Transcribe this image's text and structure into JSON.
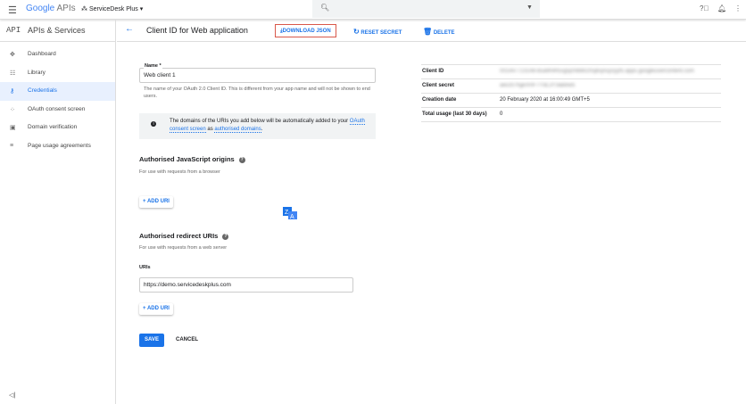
{
  "topbar": {
    "logo_brand": "Google",
    "logo_product": "APIs",
    "project": "ServiceDesk Plus"
  },
  "sidebar": {
    "api_badge": "API",
    "title": "APIs & Services",
    "items": [
      {
        "label": "Dashboard",
        "icon": "dashboard-icon"
      },
      {
        "label": "Library",
        "icon": "library-icon"
      },
      {
        "label": "Credentials",
        "icon": "key-icon",
        "active": true
      },
      {
        "label": "OAuth consent screen",
        "icon": "consent-icon"
      },
      {
        "label": "Domain verification",
        "icon": "domain-icon"
      },
      {
        "label": "Page usage agreements",
        "icon": "agreements-icon"
      }
    ]
  },
  "header": {
    "title": "Client ID for Web application",
    "download": "DOWNLOAD JSON",
    "reset": "RESET SECRET",
    "delete": "DELETE"
  },
  "form": {
    "name_label": "Name *",
    "name_value": "Web client 1",
    "name_help": "The name of your OAuth 2.0 Client ID. This is different from your app name and will not be shown to end users.",
    "info_pre": "The domains of the URIs you add below will be automatically added to your ",
    "info_link1": "OAuth consent screen",
    "info_mid": " as ",
    "info_link2": "authorised domains",
    "info_post": ".",
    "js_title": "Authorised JavaScript origins",
    "js_help": "For use with requests from a browser",
    "add_uri": "+ ADD URI",
    "redirect_title": "Authorised redirect URIs",
    "redirect_help": "For use with requests from a web server",
    "uris_label": "URIs",
    "uri_value": "https://demo.servicedeskplus.com",
    "add_uri2": "+ ADD URI",
    "save": "SAVE",
    "cancel": "CANCEL"
  },
  "details": [
    {
      "key": "Client ID",
      "value": "001447723148-8ua9h4h5sg5j0nbb61h5jbsjnuysyyf5.apps.googleusercontent.com",
      "blurred": true
    },
    {
      "key": "Client secret",
      "value": "aeDzt7hgeXHFTYdL3Y3aBew5",
      "blurred": true
    },
    {
      "key": "Creation date",
      "value": "20 February 2020 at 16:00:49 GMT+5"
    },
    {
      "key": "Total usage (last 30 days)",
      "value": "0"
    }
  ]
}
